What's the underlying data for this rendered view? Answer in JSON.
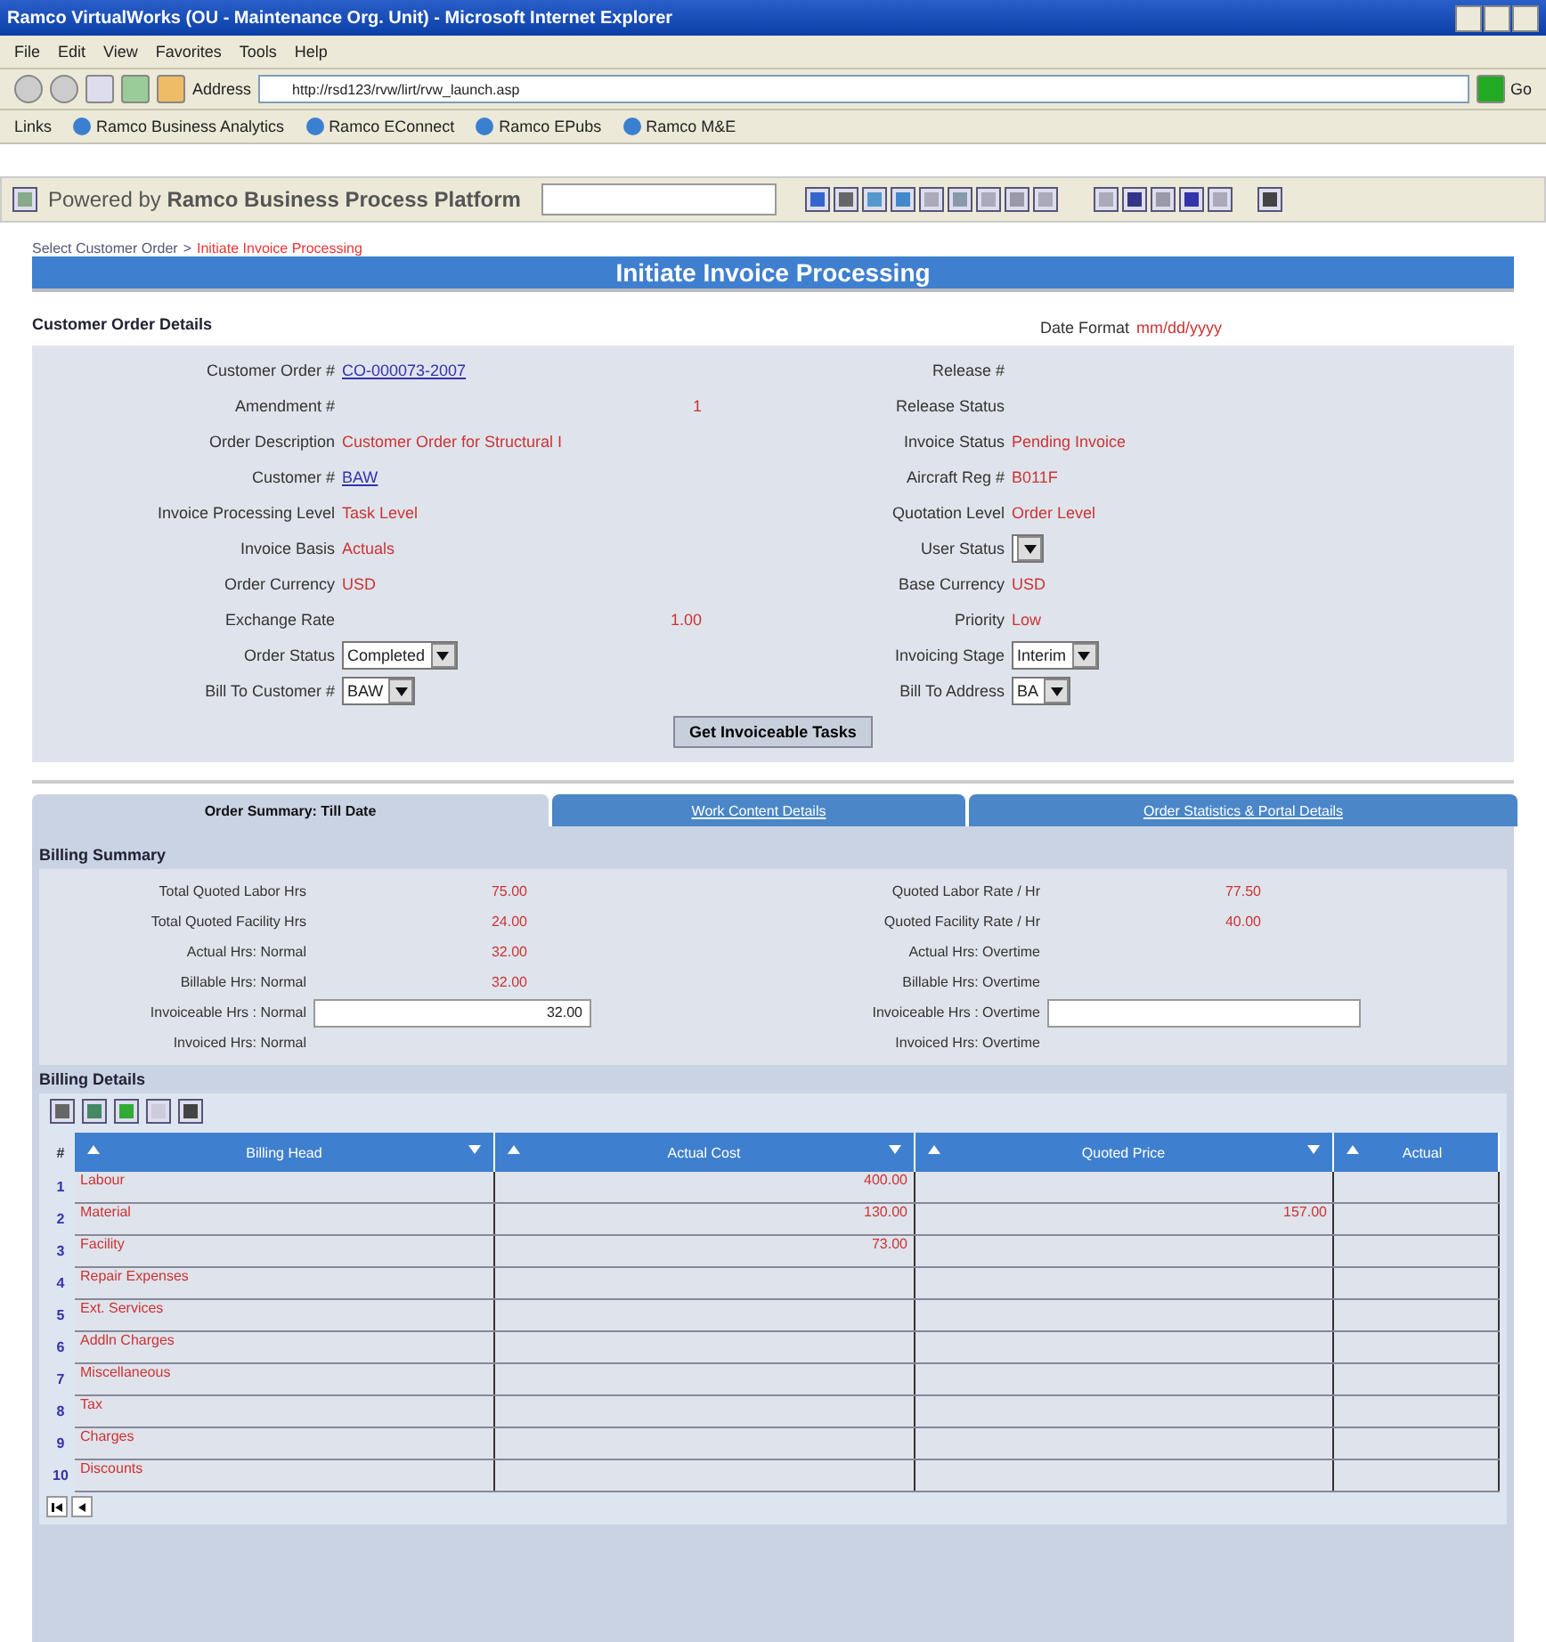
{
  "browser": {
    "title": "Ramco VirtualWorks (OU - Maintenance Org. Unit) - Microsoft Internet Explorer",
    "menu": [
      "File",
      "Edit",
      "View",
      "Favorites",
      "Tools",
      "Help"
    ],
    "address_label": "Address",
    "url": "http://rsd123/rvw/lirt/rvw_launch.asp",
    "go_label": "Go",
    "links_label": "Links",
    "links": [
      "Ramco Business Analytics",
      "Ramco EConnect",
      "Ramco EPubs",
      "Ramco M&E"
    ]
  },
  "app_bar": {
    "powered_by": "Powered by **Ramco Business Process Platform**"
  },
  "breadcrumb": [
    {
      "label": "Select Customer Order",
      "kind": "link"
    },
    {
      "label": ">",
      "kind": "separator"
    },
    {
      "label": "Initiate Invoice Processing",
      "kind": "current"
    }
  ],
  "page_title": "Initiate Invoice Processing",
  "order_details": {
    "title": "Customer Order Details",
    "date_format_label": "Date Format",
    "date_format_value": "mm/dd/yyyy",
    "left": [
      {
        "label": "Customer Order #",
        "value": "CO-000073-2007",
        "kind": "link"
      },
      {
        "label": "Amendment #",
        "value": "1",
        "kind": "number"
      },
      {
        "label": "Order Description",
        "value": "Customer Order for Structural I",
        "kind": "text"
      },
      {
        "label": "Customer #",
        "value": "BAW",
        "kind": "link"
      },
      {
        "label": "Invoice Processing Level",
        "value": "Task Level",
        "kind": "text"
      },
      {
        "label": "Invoice Basis",
        "value": "Actuals",
        "kind": "text"
      },
      {
        "label": "Order Currency",
        "value": "USD",
        "kind": "text"
      },
      {
        "label": "Exchange Rate",
        "value": "1.00",
        "kind": "number"
      },
      {
        "label": "Order Status",
        "value": "Completed",
        "kind": "select"
      },
      {
        "label": "Bill To Customer #",
        "value": "BAW",
        "kind": "select"
      }
    ],
    "right": [
      {
        "label": "Release #",
        "kind": "empty"
      },
      {
        "label": "Release Status",
        "kind": "empty"
      },
      {
        "label": "Invoice Status",
        "value": "Pending Invoice",
        "kind": "text"
      },
      {
        "label": "Aircraft Reg #",
        "value": "B011F",
        "kind": "text"
      },
      {
        "label": "Quotation Level",
        "value": "Order Level",
        "kind": "text"
      },
      {
        "label": "User Status",
        "kind": "select"
      },
      {
        "label": "Base Currency",
        "value": "USD",
        "kind": "text"
      },
      {
        "label": "Priority",
        "value": "Low",
        "kind": "text"
      },
      {
        "label": "Invoicing Stage",
        "value": "Interim",
        "kind": "select"
      },
      {
        "label": "Bill To Address",
        "value": "BA",
        "kind": "select"
      }
    ],
    "button": "Get Invoiceable Tasks"
  },
  "tabs": [
    {
      "label": "Order Summary: Till Date",
      "selected": true
    },
    {
      "label": "Work Content Details",
      "selected": false
    },
    {
      "label": "Order Statistics & Portal Details",
      "selected": false
    }
  ],
  "billing_summary": {
    "title": "Billing Summary",
    "left": [
      {
        "label": "Total Quoted Labor Hrs",
        "value": "75.00",
        "kind": "text"
      },
      {
        "label": "Total Quoted Facility Hrs",
        "value": "24.00",
        "kind": "text"
      },
      {
        "label": "Actual Hrs: Normal",
        "value": "32.00",
        "kind": "text"
      },
      {
        "label": "Billable Hrs: Normal",
        "value": "32.00",
        "kind": "text"
      },
      {
        "label": "Invoiceable Hrs : Normal",
        "value": "32.00",
        "kind": "input"
      },
      {
        "label": "Invoiced Hrs: Normal",
        "kind": "empty"
      }
    ],
    "right": [
      {
        "label": "Quoted Labor Rate / Hr",
        "value": "77.50",
        "kind": "text"
      },
      {
        "label": "Quoted Facility Rate / Hr",
        "value": "40.00",
        "kind": "text"
      },
      {
        "label": "Actual Hrs: Overtime",
        "kind": "empty"
      },
      {
        "label": "Billable Hrs: Overtime",
        "kind": "empty"
      },
      {
        "label": "Invoiceable Hrs : Overtime",
        "kind": "input"
      },
      {
        "label": "Invoiced Hrs: Overtime",
        "kind": "empty"
      }
    ]
  },
  "billing_details": {
    "title": "Billing Details",
    "columns": [
      "#",
      "Billing Head",
      "Actual Cost",
      "Quoted Price",
      "Actual"
    ],
    "rows": [
      [
        "1",
        "Labour",
        "400.00",
        "",
        ""
      ],
      [
        "2",
        "Material",
        "130.00",
        "157.00",
        ""
      ],
      [
        "3",
        "Facility",
        "73.00",
        "",
        ""
      ],
      [
        "4",
        "Repair Expenses",
        "",
        "",
        ""
      ],
      [
        "5",
        "Ext. Services",
        "",
        "",
        ""
      ],
      [
        "6",
        "Addln Charges",
        "",
        "",
        ""
      ],
      [
        "7",
        "Miscellaneous",
        "",
        "",
        ""
      ],
      [
        "8",
        "Tax",
        "",
        "",
        ""
      ],
      [
        "9",
        "Charges",
        "",
        "",
        ""
      ],
      [
        "10",
        "Discounts",
        "",
        "",
        ""
      ]
    ]
  }
}
